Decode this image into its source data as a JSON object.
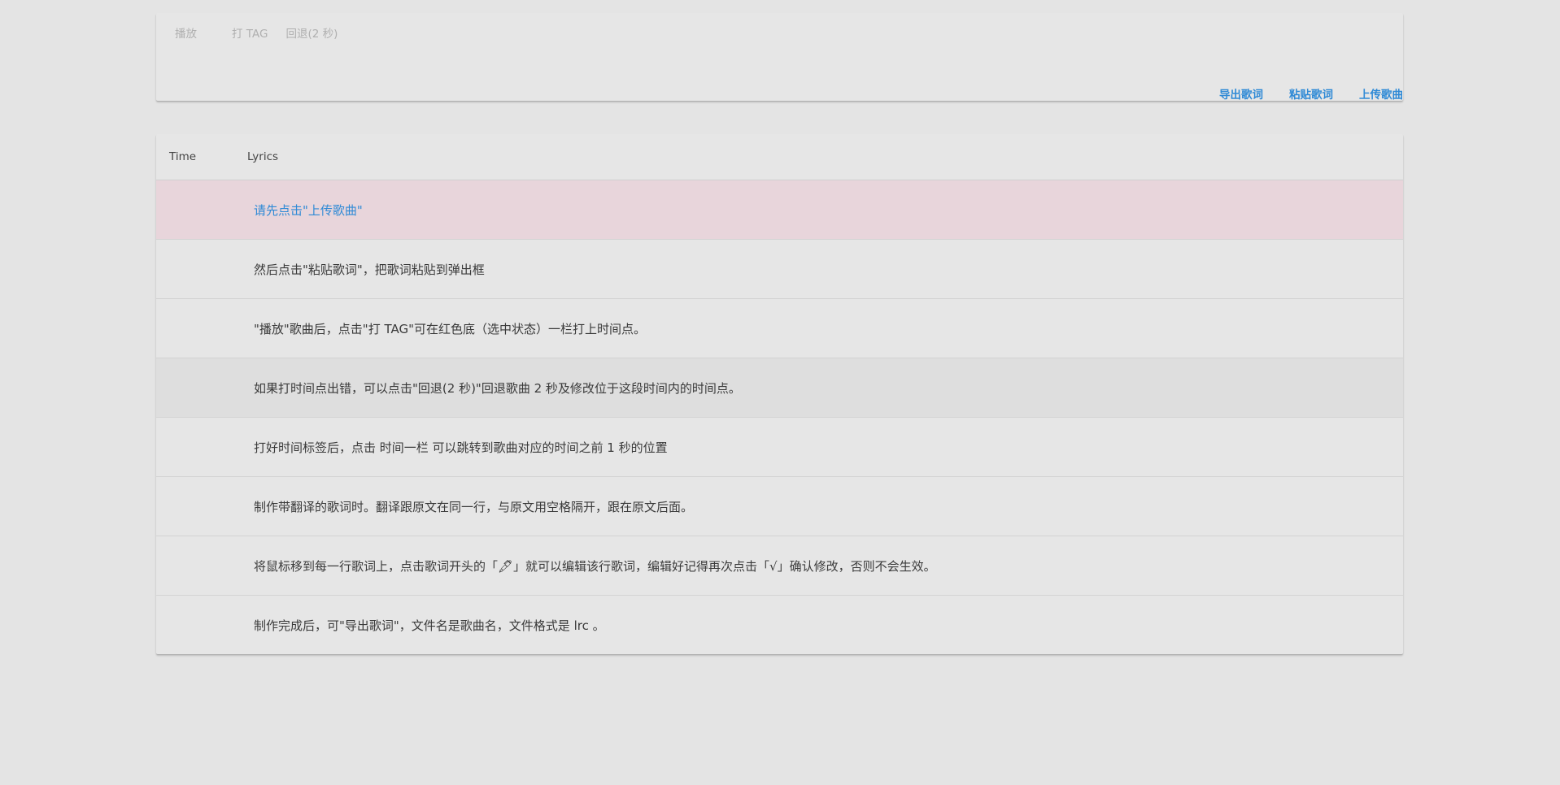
{
  "toolbar": {
    "play_label": "播放",
    "tag_label": "打 TAG",
    "rewind_label": "回退(2 秒)",
    "export_label": "导出歌词",
    "paste_label": "粘贴歌词",
    "upload_label": "上传歌曲"
  },
  "table": {
    "headers": {
      "time": "Time",
      "lyrics": "Lyrics"
    },
    "rows": [
      {
        "time": "",
        "lyric": "请先点击\"上传歌曲\"",
        "state": "selected"
      },
      {
        "time": "",
        "lyric": "然后点击\"粘贴歌词\"，把歌词粘贴到弹出框",
        "state": "normal"
      },
      {
        "time": "",
        "lyric": "\"播放\"歌曲后，点击\"打 TAG\"可在红色底（选中状态）一栏打上时间点。",
        "state": "normal"
      },
      {
        "time": "",
        "lyric": "如果打时间点出错，可以点击\"回退(2 秒)\"回退歌曲 2 秒及修改位于这段时间内的时间点。",
        "state": "hover"
      },
      {
        "time": "",
        "lyric": "打好时间标签后，点击 时间一栏 可以跳转到歌曲对应的时间之前 1 秒的位置",
        "state": "normal"
      },
      {
        "time": "",
        "lyric": "制作带翻译的歌词时。翻译跟原文在同一行，与原文用空格隔开，跟在原文后面。",
        "state": "normal"
      },
      {
        "time": "",
        "lyric": "将鼠标移到每一行歌词上，点击歌词开头的「🖋」就可以编辑该行歌词，编辑好记得再次点击「√」确认修改，否则不会生效。",
        "state": "normal"
      },
      {
        "time": "",
        "lyric": "制作完成后，可\"导出歌词\"，文件名是歌曲名，文件格式是 lrc 。",
        "state": "normal"
      }
    ]
  },
  "colors": {
    "accent": "#2f8ad6",
    "selected_row": "#e8d5db",
    "background": "#e4e4e4"
  }
}
